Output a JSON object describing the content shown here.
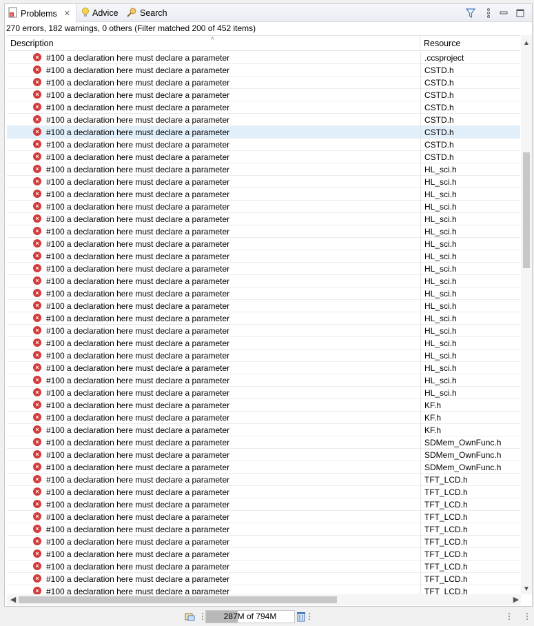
{
  "tabs": [
    {
      "label": "Problems",
      "icon": "problems-icon",
      "active": true,
      "closable": true
    },
    {
      "label": "Advice",
      "icon": "lightbulb-icon",
      "active": false,
      "closable": false
    },
    {
      "label": "Search",
      "icon": "search-icon",
      "active": false,
      "closable": false
    }
  ],
  "toolbar": {
    "filter_icon": "filter-icon",
    "menu_icon": "view-menu-icon",
    "minimize_icon": "minimize-icon",
    "maximize_icon": "maximize-icon"
  },
  "summary": "270 errors, 182 warnings, 0 others (Filter matched 200 of 452 items)",
  "columns": {
    "description": "Description",
    "resource": "Resource"
  },
  "rows": [
    {
      "description": "#100 a declaration here must declare a parameter",
      "resource": ".ccsproject",
      "selected": false
    },
    {
      "description": "#100 a declaration here must declare a parameter",
      "resource": "CSTD.h",
      "selected": false
    },
    {
      "description": "#100 a declaration here must declare a parameter",
      "resource": "CSTD.h",
      "selected": false
    },
    {
      "description": "#100 a declaration here must declare a parameter",
      "resource": "CSTD.h",
      "selected": false
    },
    {
      "description": "#100 a declaration here must declare a parameter",
      "resource": "CSTD.h",
      "selected": false
    },
    {
      "description": "#100 a declaration here must declare a parameter",
      "resource": "CSTD.h",
      "selected": false
    },
    {
      "description": "#100 a declaration here must declare a parameter",
      "resource": "CSTD.h",
      "selected": true
    },
    {
      "description": "#100 a declaration here must declare a parameter",
      "resource": "CSTD.h",
      "selected": false
    },
    {
      "description": "#100 a declaration here must declare a parameter",
      "resource": "CSTD.h",
      "selected": false
    },
    {
      "description": "#100 a declaration here must declare a parameter",
      "resource": "HL_sci.h",
      "selected": false
    },
    {
      "description": "#100 a declaration here must declare a parameter",
      "resource": "HL_sci.h",
      "selected": false
    },
    {
      "description": "#100 a declaration here must declare a parameter",
      "resource": "HL_sci.h",
      "selected": false
    },
    {
      "description": "#100 a declaration here must declare a parameter",
      "resource": "HL_sci.h",
      "selected": false
    },
    {
      "description": "#100 a declaration here must declare a parameter",
      "resource": "HL_sci.h",
      "selected": false
    },
    {
      "description": "#100 a declaration here must declare a parameter",
      "resource": "HL_sci.h",
      "selected": false
    },
    {
      "description": "#100 a declaration here must declare a parameter",
      "resource": "HL_sci.h",
      "selected": false
    },
    {
      "description": "#100 a declaration here must declare a parameter",
      "resource": "HL_sci.h",
      "selected": false
    },
    {
      "description": "#100 a declaration here must declare a parameter",
      "resource": "HL_sci.h",
      "selected": false
    },
    {
      "description": "#100 a declaration here must declare a parameter",
      "resource": "HL_sci.h",
      "selected": false
    },
    {
      "description": "#100 a declaration here must declare a parameter",
      "resource": "HL_sci.h",
      "selected": false
    },
    {
      "description": "#100 a declaration here must declare a parameter",
      "resource": "HL_sci.h",
      "selected": false
    },
    {
      "description": "#100 a declaration here must declare a parameter",
      "resource": "HL_sci.h",
      "selected": false
    },
    {
      "description": "#100 a declaration here must declare a parameter",
      "resource": "HL_sci.h",
      "selected": false
    },
    {
      "description": "#100 a declaration here must declare a parameter",
      "resource": "HL_sci.h",
      "selected": false
    },
    {
      "description": "#100 a declaration here must declare a parameter",
      "resource": "HL_sci.h",
      "selected": false
    },
    {
      "description": "#100 a declaration here must declare a parameter",
      "resource": "HL_sci.h",
      "selected": false
    },
    {
      "description": "#100 a declaration here must declare a parameter",
      "resource": "HL_sci.h",
      "selected": false
    },
    {
      "description": "#100 a declaration here must declare a parameter",
      "resource": "HL_sci.h",
      "selected": false
    },
    {
      "description": "#100 a declaration here must declare a parameter",
      "resource": "KF.h",
      "selected": false
    },
    {
      "description": "#100 a declaration here must declare a parameter",
      "resource": "KF.h",
      "selected": false
    },
    {
      "description": "#100 a declaration here must declare a parameter",
      "resource": "KF.h",
      "selected": false
    },
    {
      "description": "#100 a declaration here must declare a parameter",
      "resource": "SDMem_OwnFunc.h",
      "selected": false
    },
    {
      "description": "#100 a declaration here must declare a parameter",
      "resource": "SDMem_OwnFunc.h",
      "selected": false
    },
    {
      "description": "#100 a declaration here must declare a parameter",
      "resource": "SDMem_OwnFunc.h",
      "selected": false
    },
    {
      "description": "#100 a declaration here must declare a parameter",
      "resource": "TFT_LCD.h",
      "selected": false
    },
    {
      "description": "#100 a declaration here must declare a parameter",
      "resource": "TFT_LCD.h",
      "selected": false
    },
    {
      "description": "#100 a declaration here must declare a parameter",
      "resource": "TFT_LCD.h",
      "selected": false
    },
    {
      "description": "#100 a declaration here must declare a parameter",
      "resource": "TFT_LCD.h",
      "selected": false
    },
    {
      "description": "#100 a declaration here must declare a parameter",
      "resource": "TFT_LCD.h",
      "selected": false
    },
    {
      "description": "#100 a declaration here must declare a parameter",
      "resource": "TFT_LCD.h",
      "selected": false
    },
    {
      "description": "#100 a declaration here must declare a parameter",
      "resource": "TFT_LCD.h",
      "selected": false
    },
    {
      "description": "#100 a declaration here must declare a parameter",
      "resource": "TFT_LCD.h",
      "selected": false
    },
    {
      "description": "#100 a declaration here must declare a parameter",
      "resource": "TFT_LCD.h",
      "selected": false
    },
    {
      "description": "#100 a declaration here must declare a parameter",
      "resource": "TFT_LCD.h",
      "selected": false
    }
  ],
  "heap": {
    "label": "287M of 794M",
    "fraction": 0.36
  },
  "icons": {
    "row_error": "error-icon",
    "gc": "trash-icon",
    "heap_tool": "heap-icon"
  }
}
